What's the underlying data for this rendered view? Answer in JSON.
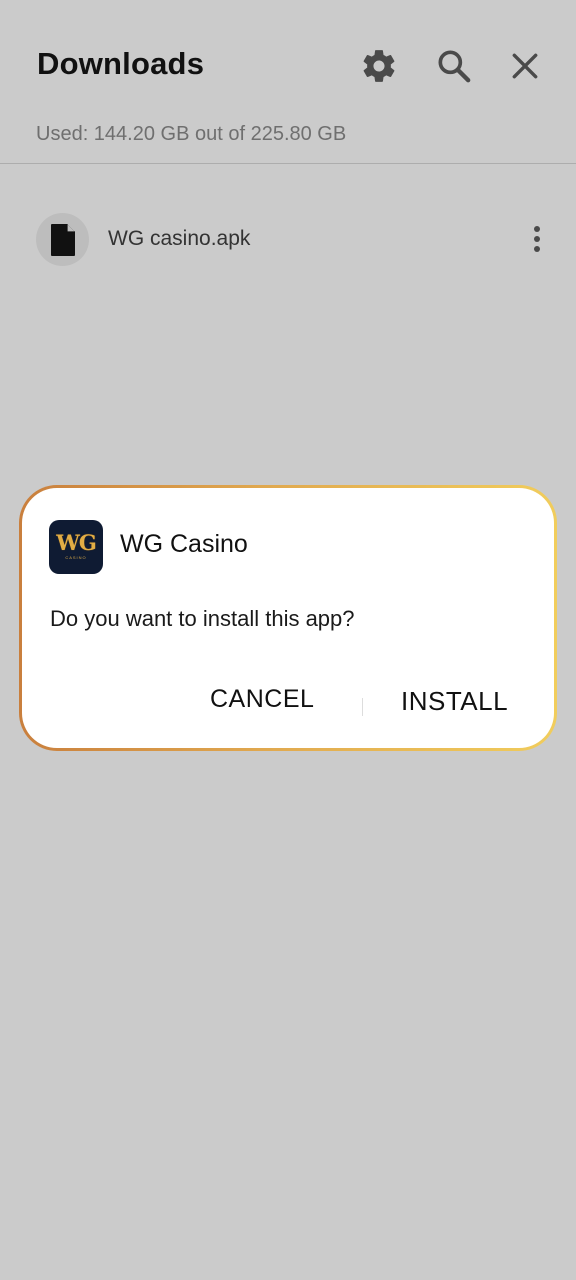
{
  "header": {
    "title": "Downloads",
    "storage_usage": "Used: 144.20 GB out of 225.80 GB"
  },
  "icons": {
    "settings": "gear-icon",
    "search": "search-icon",
    "close": "close-icon",
    "file": "file-icon",
    "more": "more-vertical-icon"
  },
  "files": [
    {
      "name": "WG casino.apk"
    }
  ],
  "dialog": {
    "app_icon_text": "WG",
    "app_icon_subtext": "CASINO",
    "app_name": "WG Casino",
    "message": "Do you want to install this app?",
    "cancel_label": "CANCEL",
    "install_label": "INSTALL"
  },
  "colors": {
    "background": "#cbcbcb",
    "dialog_border_start": "#c97f3d",
    "dialog_border_end": "#f1cd5c",
    "app_icon_bg": "#0f1b33",
    "app_icon_gold": "#e2ad45"
  }
}
